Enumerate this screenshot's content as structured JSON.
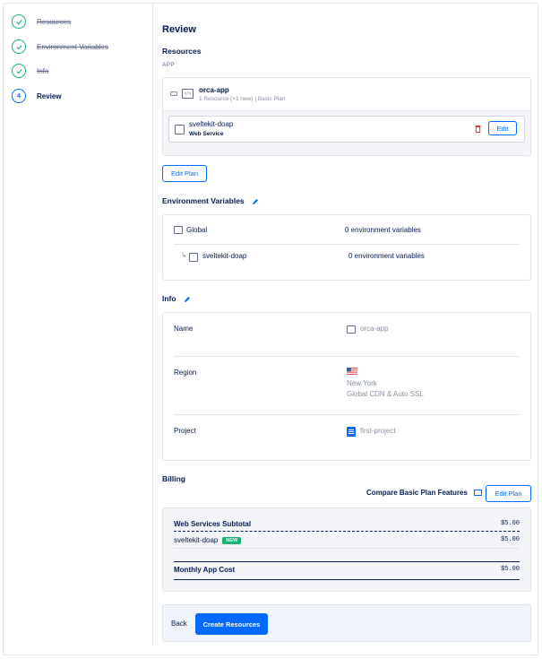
{
  "steps": [
    {
      "label": "Resources",
      "state": "done"
    },
    {
      "label": "Environment Variables",
      "state": "done"
    },
    {
      "label": "Info",
      "state": "done"
    },
    {
      "label": "Review",
      "state": "current",
      "number": "4"
    }
  ],
  "review": {
    "title": "Review",
    "resources": {
      "heading": "Resources",
      "app_caption": "APP",
      "app_name": "orca-app",
      "app_meta": "1 Resource (+1 new) | Basic Plan",
      "component_name": "sveltekit-doap",
      "component_type": "Web Service",
      "edit_label": "Edit",
      "edit_plan_label": "Edit Plan"
    },
    "env": {
      "heading": "Environment Variables",
      "global_label": "Global",
      "global_count": "0 environment variables",
      "component_name": "sveltekit-doap",
      "component_count": "0 environment variables"
    },
    "info": {
      "heading": "Info",
      "name_label": "Name",
      "name_value": "orca-app",
      "region_label": "Region",
      "region_city": "New York",
      "region_extra": "Global CDN & Auto SSL",
      "project_label": "Project",
      "project_value": "first-project"
    },
    "billing": {
      "heading": "Billing",
      "compare_label": "Compare Basic Plan Features",
      "edit_plan_label": "Edit Plan",
      "subtotal_label": "Web Services Subtotal",
      "subtotal_value": "$5.00",
      "item_name": "sveltekit-doap",
      "item_badge": "NEW",
      "item_value": "$5.00",
      "monthly_label": "Monthly App Cost",
      "monthly_value": "$5.00"
    },
    "footer": {
      "back_label": "Back",
      "create_label": "Create Resources"
    }
  },
  "colors": {
    "accent": "#0069ff",
    "success": "#15b374",
    "danger": "#e5312f",
    "badge": "#15b374"
  }
}
